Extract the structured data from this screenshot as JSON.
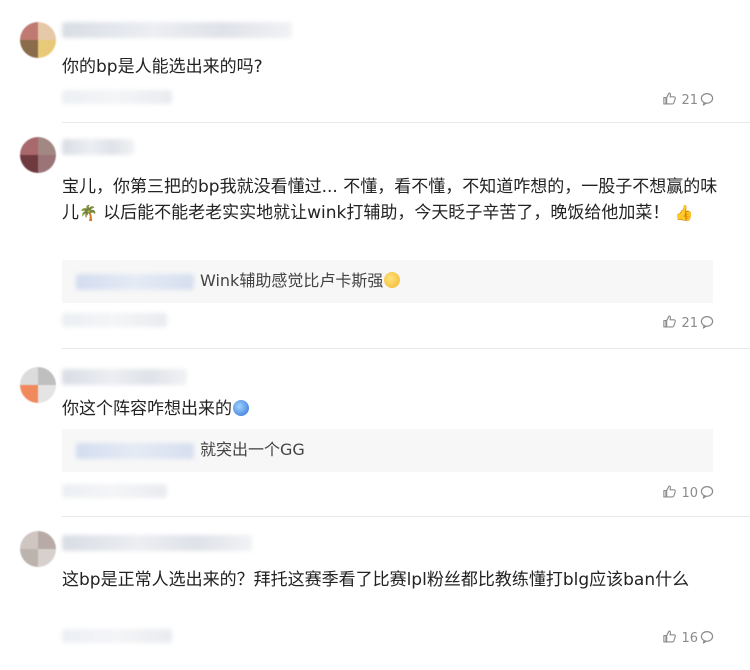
{
  "comments": [
    {
      "text": "你的bp是人能选出来的吗?",
      "likes": "21",
      "avatar_colors": [
        "#c07a72",
        "#e6c9a8",
        "#8a6b4a",
        "#e8c977"
      ]
    },
    {
      "text_parts": [
        "宝儿，你第三把的bp我就没看懂过... 不懂，看不懂，不知道咋想的，一股子不想赢的味儿",
        " 以后能不能老老实实地就让wink打辅助，今天眨子辛苦了，晚饭给他加菜！"
      ],
      "emojis": [
        "🌴",
        "👍"
      ],
      "reply": "Wink辅助感觉比卢卡斯强",
      "likes": "21",
      "avatar_colors": [
        "#a8686c",
        "#a38783",
        "#6e3a3e",
        "#9b7478"
      ]
    },
    {
      "text": "你这个阵容咋想出来的",
      "reply": "就突出一个GG",
      "likes": "10",
      "avatar_colors": [
        "#dcdcdc",
        "#bfbfbf",
        "#f08a5d",
        "#e4e4e4"
      ]
    },
    {
      "text": "这bp是正常人选出来的？拜托这赛季看了比赛lpl粉丝都比教练懂打blg应该ban什么",
      "likes": "16",
      "avatar_colors": [
        "#cfc6c2",
        "#b8aaa4",
        "#bdb3ad",
        "#d8d0cc"
      ]
    }
  ],
  "icons": {
    "like": "thumbs-up-icon",
    "more": "comment-bubble-icon"
  },
  "colors": {
    "text": "#222222",
    "meta": "#8b8b8b",
    "reply_bg": "#f7f7f7",
    "divider": "#e9e9e9"
  }
}
